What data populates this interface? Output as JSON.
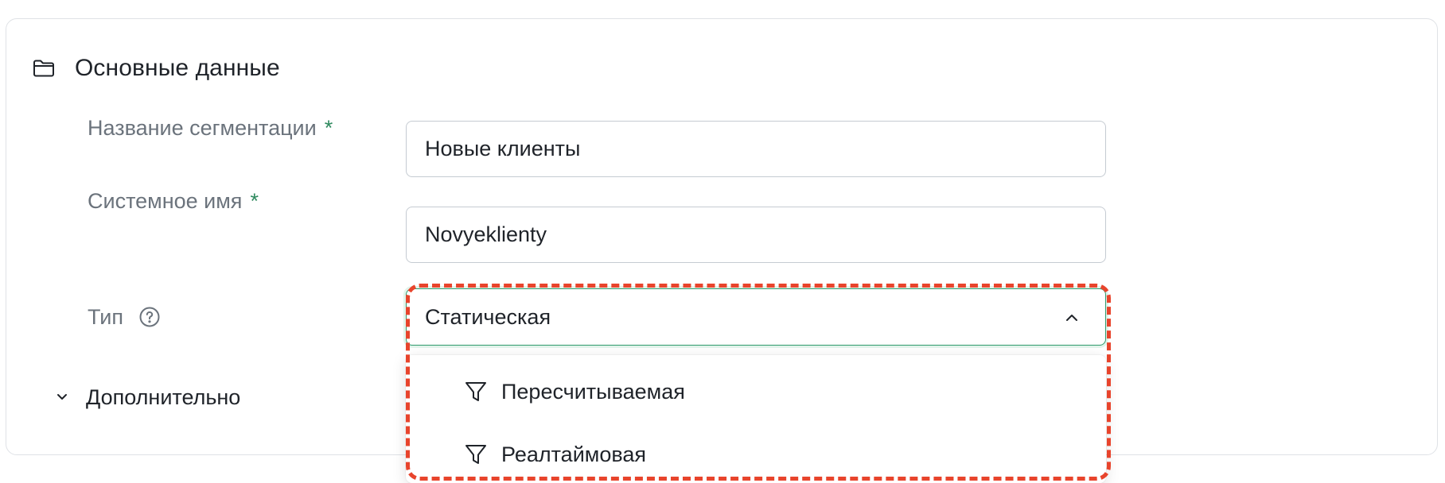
{
  "section": {
    "title": "Основные данные",
    "icon": "folder-icon"
  },
  "fields": {
    "name": {
      "label": "Название сегментации",
      "required_mark": "*",
      "value": "Новые клиенты"
    },
    "system_name": {
      "label": "Системное имя",
      "required_mark": "*",
      "value": "Novyeklienty"
    },
    "type": {
      "label": "Тип",
      "help_icon": "question-circle-icon",
      "selected": "Статическая",
      "options": [
        {
          "label": "Пересчитываемая",
          "icon": "filter-icon"
        },
        {
          "label": "Реалтаймовая",
          "icon": "filter-icon"
        }
      ]
    }
  },
  "advanced": {
    "label": "Дополнительно",
    "icon": "chevron-down-icon"
  },
  "colors": {
    "accent": "#2f9a6c",
    "required": "#2f8a5f",
    "highlight": "#e8442c",
    "label": "#6b737c",
    "border": "#c5cbd2"
  }
}
